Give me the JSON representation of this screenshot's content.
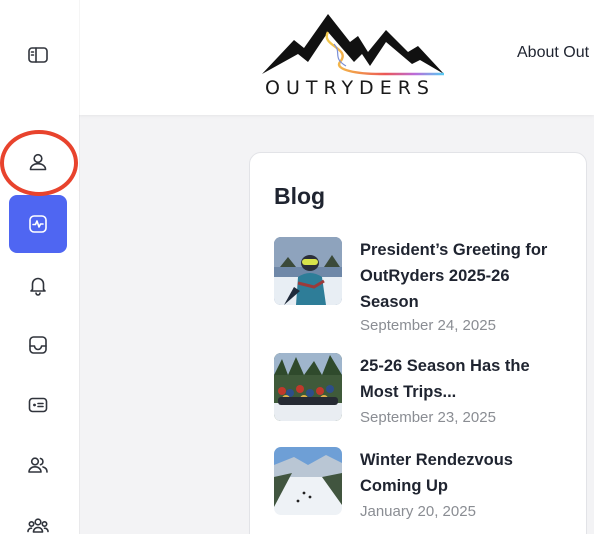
{
  "header": {
    "brand": "OUTRYDERS",
    "nav_about": "About Out"
  },
  "sidebar": {
    "items": [
      {
        "icon": "sidebar-toggle-icon"
      },
      {
        "icon": "user-icon"
      },
      {
        "icon": "activity-icon",
        "active": true
      },
      {
        "icon": "bell-icon"
      },
      {
        "icon": "inbox-icon"
      },
      {
        "icon": "id-card-icon"
      },
      {
        "icon": "users-icon"
      },
      {
        "icon": "group-icon"
      }
    ]
  },
  "blog": {
    "title": "Blog",
    "posts": [
      {
        "title": "President’s Greeting for OutRyders 2025-26 Season",
        "date": "September 24, 2025",
        "thumb": "skier-portrait"
      },
      {
        "title": "25-26 Season Has the Most Trips...",
        "date": "September 23, 2025",
        "thumb": "group-photo"
      },
      {
        "title": "Winter Rendezvous Coming Up",
        "date": "January 20, 2025",
        "thumb": "ski-slope"
      }
    ]
  },
  "colors": {
    "accent": "#4f66f2",
    "highlight": "#e8432d",
    "muted_text": "#8a8d93"
  }
}
